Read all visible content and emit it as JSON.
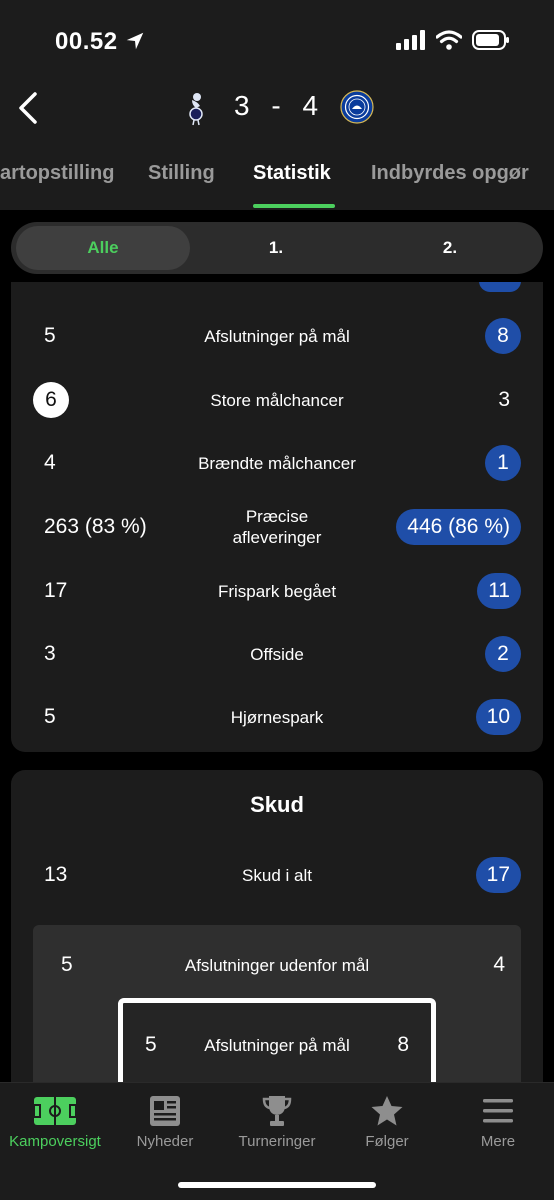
{
  "status_bar": {
    "time": "00.52"
  },
  "header": {
    "home_score": "3",
    "separator": "-",
    "away_score": "4",
    "tabs": [
      {
        "label": "artopstilling"
      },
      {
        "label": "Stilling"
      },
      {
        "label": "Statistik"
      },
      {
        "label": "Indbyrdes opgør"
      }
    ],
    "active_tab": "Statistik"
  },
  "period_filter": {
    "options": [
      "Alle",
      "1.",
      "2."
    ],
    "selected": "Alle"
  },
  "stats": [
    {
      "label": "Afslutninger på mål",
      "home": "5",
      "away": "8",
      "highlight": "away"
    },
    {
      "label": "Store målchancer",
      "home": "6",
      "away": "3",
      "highlight": "home"
    },
    {
      "label": "Brændte målchancer",
      "home": "4",
      "away": "1",
      "highlight": "away"
    },
    {
      "label": "Præcise afleveringer",
      "home": "263 (83 %)",
      "away": "446 (86 %)",
      "highlight": "away"
    },
    {
      "label": "Frispark begået",
      "home": "17",
      "away": "11",
      "highlight": "away"
    },
    {
      "label": "Offside",
      "home": "3",
      "away": "2",
      "highlight": "away"
    },
    {
      "label": "Hjørnespark",
      "home": "5",
      "away": "10",
      "highlight": "away"
    }
  ],
  "shots": {
    "title": "Skud",
    "total": {
      "label": "Skud i alt",
      "home": "13",
      "away": "17",
      "highlight": "away"
    },
    "off_target": {
      "label": "Afslutninger udenfor mål",
      "home": "5",
      "away": "4"
    },
    "on_target": {
      "label": "Afslutninger på mål",
      "home": "5",
      "away": "8"
    }
  },
  "bottom_nav": {
    "items": [
      {
        "label": "Kampoversigt",
        "icon": "pitch-icon"
      },
      {
        "label": "Nyheder",
        "icon": "newspaper-icon"
      },
      {
        "label": "Turneringer",
        "icon": "trophy-icon"
      },
      {
        "label": "Følger",
        "icon": "star-icon"
      },
      {
        "label": "Mere",
        "icon": "menu-icon"
      }
    ],
    "active": "Kampoversigt"
  },
  "colors": {
    "accent_green": "#4ccf5e",
    "pill_blue": "#1f4ea8",
    "background": "#1c1c1c"
  }
}
